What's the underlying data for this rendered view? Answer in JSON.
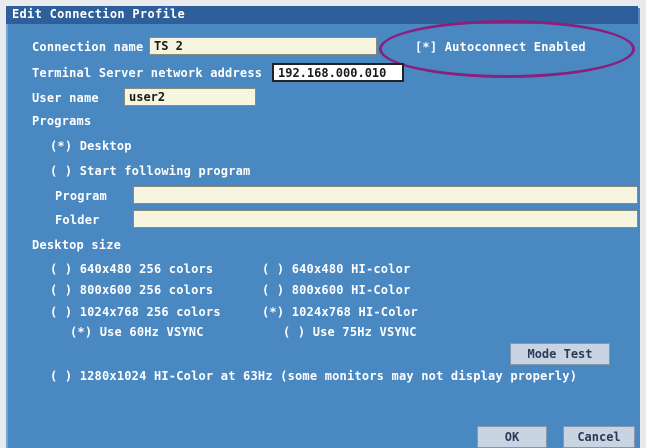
{
  "window": {
    "title": "Edit Connection Profile"
  },
  "connection": {
    "name_label": "Connection name",
    "name_value": "TS 2",
    "autoconnect": "[*] Autoconnect Enabled",
    "address_label": "Terminal Server network address",
    "address_value": "192.168.000.010",
    "user_label": "User name",
    "user_value": "user2"
  },
  "programs": {
    "heading": "Programs",
    "desktop": "(*) Desktop",
    "start_program": "( ) Start following program",
    "program_label": "Program",
    "program_value": "",
    "folder_label": "Folder",
    "folder_value": ""
  },
  "desktop_size": {
    "heading": "Desktop size",
    "opt_640_256": "( ) 640x480 256 colors",
    "opt_640_hi": "( ) 640x480 HI-color",
    "opt_800_256": "( ) 800x600 256 colors",
    "opt_800_hi": "( ) 800x600 HI-Color",
    "opt_1024_256": "( ) 1024x768 256 colors",
    "opt_1024_hi": "(*) 1024x768 HI-Color",
    "vsync_60": "(*) Use 60Hz VSYNC",
    "vsync_75": "( ) Use 75Hz VSYNC",
    "mode_test": "Mode Test",
    "opt_1280": "( ) 1280x1024 HI-Color at 63Hz (some monitors may not display properly)"
  },
  "footer": {
    "ok": "OK",
    "cancel": "Cancel"
  },
  "colors": {
    "panel": "#4a88c2",
    "titlebar": "#2f5f9a",
    "annotation": "#8a1f7d"
  }
}
